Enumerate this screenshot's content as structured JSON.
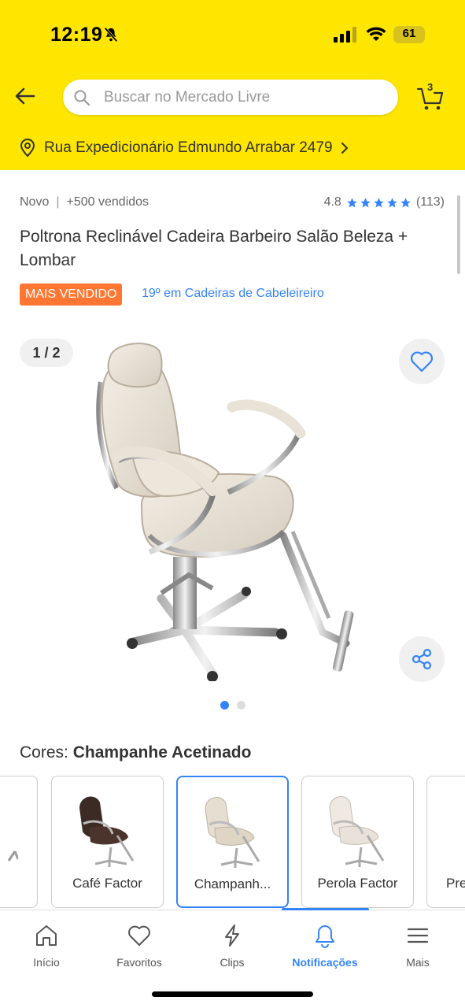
{
  "status_bar": {
    "time": "12:19",
    "battery": "61"
  },
  "search": {
    "placeholder": "Buscar no Mercado Livre"
  },
  "cart": {
    "count": "3"
  },
  "address": {
    "text": "Rua Expedicionário Edmundo Arrabar 2479"
  },
  "product": {
    "condition": "Novo",
    "sold": "+500 vendidos",
    "rating": "4.8",
    "reviews": "(113)",
    "stars": 5,
    "title": "Poltrona Reclinável Cadeira Barbeiro Salão Beleza + Lombar",
    "badge": "MAIS VENDIDO",
    "rank": "19º em Cadeiras de Cabeleireiro"
  },
  "gallery": {
    "counter": "1 / 2",
    "active_dot": 1,
    "total_dots": 2
  },
  "colors": {
    "label": "Cores:",
    "selected": "Champanhe Acetinado",
    "options": [
      {
        "label": "ng"
      },
      {
        "label": "Café Factor"
      },
      {
        "label": "Champanh..."
      },
      {
        "label": "Perola Factor"
      },
      {
        "label": "Pre"
      }
    ]
  },
  "nav": {
    "items": [
      {
        "label": "Início"
      },
      {
        "label": "Favoritos"
      },
      {
        "label": "Clips"
      },
      {
        "label": "Notificações"
      },
      {
        "label": "Mais"
      }
    ]
  },
  "theme": {
    "yellow": "#FFE600",
    "blue": "#3483FA",
    "orange": "#FF7733"
  }
}
